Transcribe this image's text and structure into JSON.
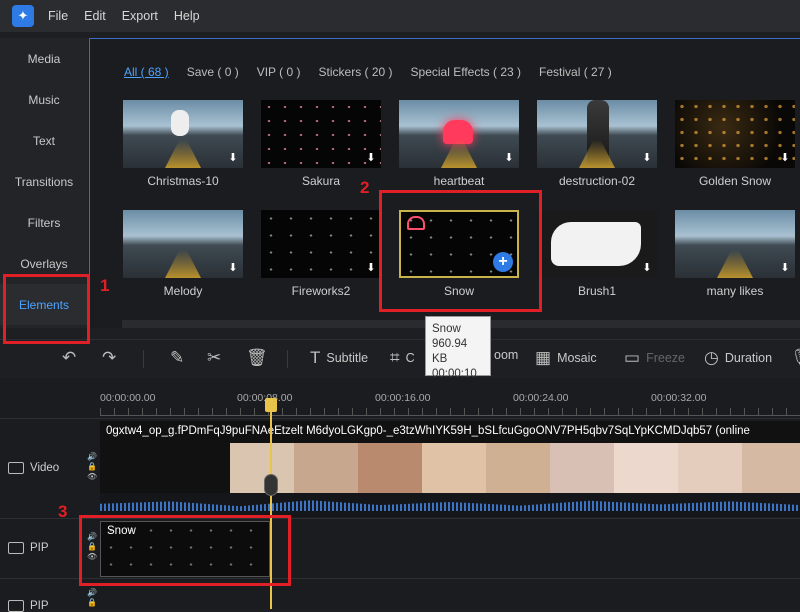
{
  "menu": {
    "items": [
      "File",
      "Edit",
      "Export",
      "Help"
    ]
  },
  "sidebar": {
    "items": [
      {
        "label": "Media"
      },
      {
        "label": "Music"
      },
      {
        "label": "Text"
      },
      {
        "label": "Transitions"
      },
      {
        "label": "Filters"
      },
      {
        "label": "Overlays"
      },
      {
        "label": "Elements"
      }
    ],
    "active": "Elements"
  },
  "library": {
    "filters": [
      "All ( 68 )",
      "Save ( 0 )",
      "VIP ( 0 )",
      "Stickers ( 20 )",
      "Special Effects ( 23 )",
      "Festival ( 27 )"
    ],
    "items": [
      {
        "label": "Christmas-10"
      },
      {
        "label": "Sakura"
      },
      {
        "label": "heartbeat"
      },
      {
        "label": "destruction-02"
      },
      {
        "label": "Golden Snow"
      },
      {
        "label": "Melody"
      },
      {
        "label": "Fireworks2"
      },
      {
        "label": "Snow"
      },
      {
        "label": "Brush1"
      },
      {
        "label": "many likes"
      }
    ]
  },
  "tooltip": {
    "name": "Snow",
    "size": "960.94 KB",
    "duration": "00:00:10"
  },
  "toolbar": {
    "subtitle": "Subtitle",
    "crop": "C",
    "zoom": "oom",
    "mosaic": "Mosaic",
    "freeze": "Freeze",
    "duration": "Duration"
  },
  "timeline": {
    "ruler": [
      "00:00:00.00",
      "00:00:08.00",
      "00:00:16.00",
      "00:00:24.00",
      "00:00:32.00"
    ],
    "tracks": {
      "video": "Video",
      "pip": "PIP",
      "pip2": "PIP"
    },
    "video_clip_name": "0gxtw4_op_g.fPDmFqJ9puFNAeEtzelt M6dyoLGKgp0-_e3tzWhIYK59H_bSLfcuGgoONV7PH5qbv7SqLYpKCMDJqb57 (online",
    "pip_clip_name": "Snow"
  },
  "annotations": [
    "1",
    "2",
    "3"
  ],
  "colors": {
    "accent": "#4da3ff",
    "annotation": "#e11f26",
    "playhead": "#e8c44a",
    "selected_border": "#c9b34a"
  }
}
